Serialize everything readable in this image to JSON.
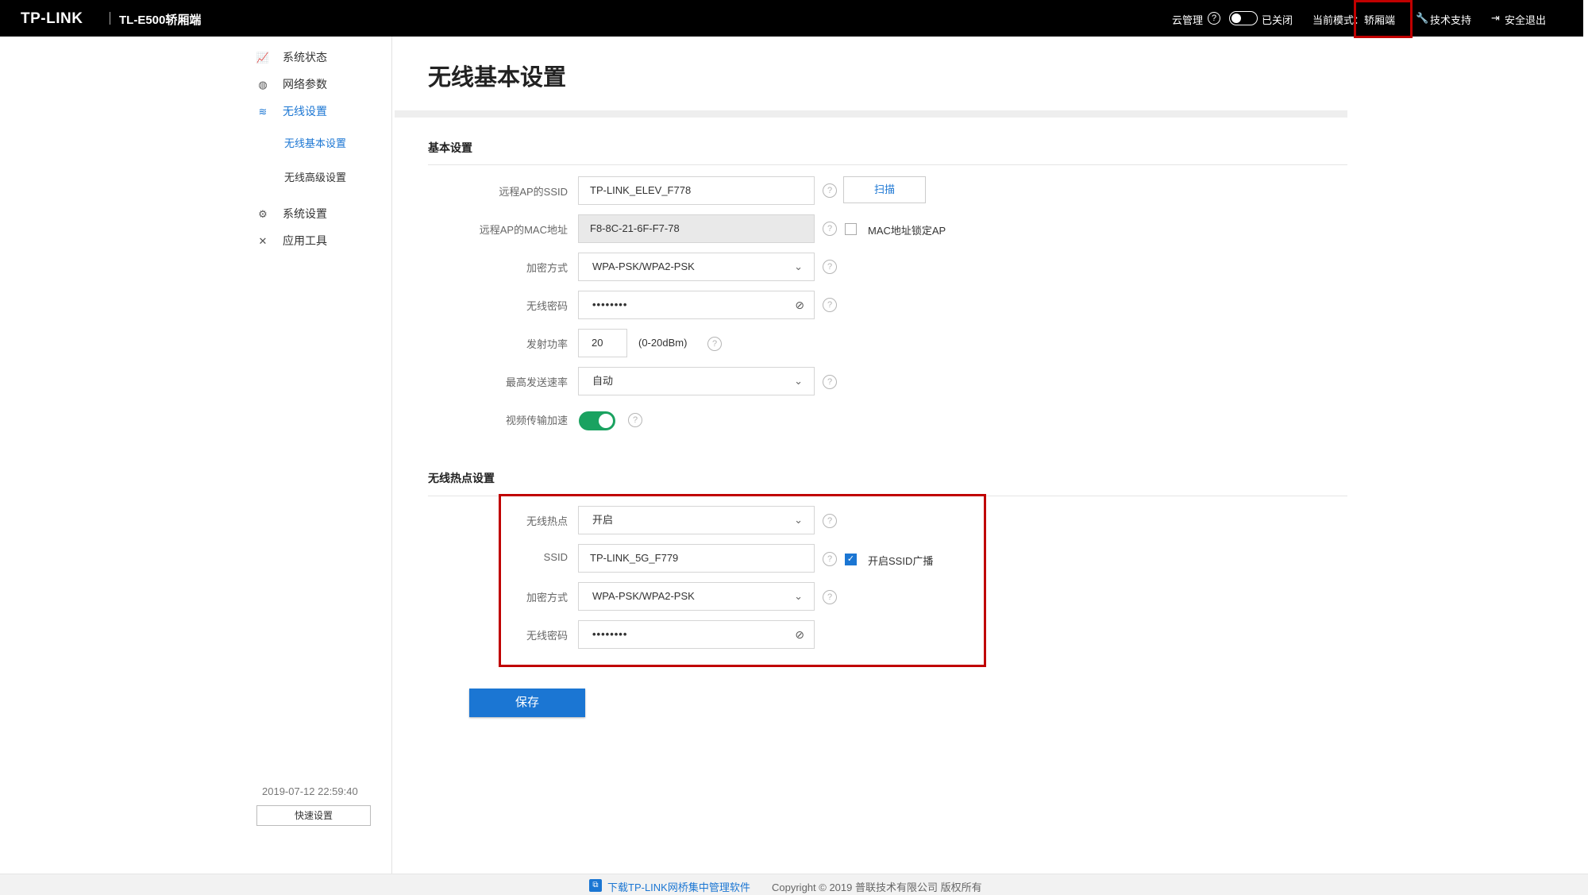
{
  "header": {
    "brand": "TP-LINK",
    "model": "TL-E500轿厢端",
    "cloud_label": "云管理",
    "cloud_status": "已关闭",
    "mode_label": "当前模式：",
    "mode_value": "轿厢端",
    "support": "技术支持",
    "logout": "安全退出"
  },
  "sidebar": {
    "items": [
      {
        "label": "系统状态",
        "icon": "chart-icon"
      },
      {
        "label": "网络参数",
        "icon": "globe-icon"
      },
      {
        "label": "无线设置",
        "icon": "wifi-icon"
      },
      {
        "label": "系统设置",
        "icon": "gear-icon"
      },
      {
        "label": "应用工具",
        "icon": "tools-icon"
      }
    ],
    "sub_items": [
      {
        "label": "无线基本设置"
      },
      {
        "label": "无线高级设置"
      }
    ],
    "datetime": "2019-07-12 22:59:40",
    "quick_setup": "快速设置"
  },
  "main": {
    "title": "无线基本设置",
    "basic": {
      "section_title": "基本设置",
      "remote_ssid_label": "远程AP的SSID",
      "remote_ssid_value": "TP-LINK_ELEV_F778",
      "scan_button": "扫描",
      "remote_mac_label": "远程AP的MAC地址",
      "remote_mac_value": "F8-8C-21-6F-F7-78",
      "mac_lock_label": "MAC地址锁定AP",
      "encryption_label": "加密方式",
      "encryption_value": "WPA-PSK/WPA2-PSK",
      "password_label": "无线密码",
      "password_value": "••••••••",
      "power_label": "发射功率",
      "power_value": "20",
      "power_unit": "(0-20dBm)",
      "rate_label": "最高发送速率",
      "rate_value": "自动",
      "video_label": "视频传输加速"
    },
    "hotspot": {
      "section_title": "无线热点设置",
      "hotspot_label": "无线热点",
      "hotspot_value": "开启",
      "ssid_label": "SSID",
      "ssid_value": "TP-LINK_5G_F779",
      "broadcast_label": "开启SSID广播",
      "encryption_label": "加密方式",
      "encryption_value": "WPA-PSK/WPA2-PSK",
      "password_label": "无线密码",
      "password_value": "••••••••"
    },
    "save_button": "保存"
  },
  "footer": {
    "download_link": "下载TP-LINK网桥集中管理软件",
    "copyright": "Copyright © 2019 普联技术有限公司 版权所有"
  },
  "colors": {
    "accent": "#1b76d3",
    "toggle_on": "#1aa260",
    "highlight": "#c00000"
  }
}
